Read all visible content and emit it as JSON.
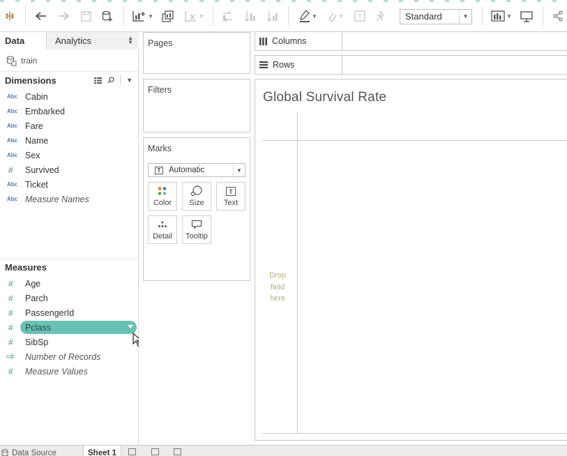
{
  "toolbar": {
    "standard_select": "Standard",
    "icons": [
      "tableau-logo-icon",
      "undo-icon",
      "redo-icon",
      "save-icon",
      "new-datasource-icon",
      "new-worksheet-icon",
      "duplicate-sheet-icon",
      "clear-sheet-icon",
      "swap-icon",
      "sort-ascending-icon",
      "sort-descending-icon",
      "highlight-icon",
      "group-icon",
      "label-icon",
      "pin-icon",
      "show-me-icon",
      "presentation-icon",
      "share-icon"
    ]
  },
  "datapane": {
    "tab_data": "Data",
    "tab_analytics": "Analytics",
    "datasource": "train",
    "dimensions_header": "Dimensions",
    "dimensions": [
      {
        "type": "Abc",
        "name": "Cabin"
      },
      {
        "type": "Abc",
        "name": "Embarked"
      },
      {
        "type": "Abc",
        "name": "Fare"
      },
      {
        "type": "Abc",
        "name": "Name"
      },
      {
        "type": "Abc",
        "name": "Sex"
      },
      {
        "type": "#",
        "name": "Survived"
      },
      {
        "type": "Abc",
        "name": "Ticket"
      },
      {
        "type": "Abc",
        "name": "Measure Names"
      }
    ],
    "measures_header": "Measures",
    "measures": [
      {
        "type": "#",
        "name": "Age"
      },
      {
        "type": "#",
        "name": "Parch"
      },
      {
        "type": "#",
        "name": "PassengerId"
      },
      {
        "type": "#",
        "name": "Pclass"
      },
      {
        "type": "#",
        "name": "SibSp"
      },
      {
        "type": "=#",
        "name": "Number of Records"
      },
      {
        "type": "#",
        "name": "Measure Values"
      }
    ]
  },
  "cards": {
    "pages": "Pages",
    "filters": "Filters",
    "marks": "Marks",
    "mark_type": "Automatic",
    "mark_type_icon": "T",
    "buttons": {
      "color": "Color",
      "size": "Size",
      "text": "Text",
      "detail": "Detail",
      "tooltip": "Tooltip"
    }
  },
  "shelves": {
    "columns": "Columns",
    "rows": "Rows"
  },
  "view": {
    "title": "Global Survival Rate",
    "drop_hint": "Drop field here"
  },
  "bottom_tabs": {
    "data_source": "Data Source",
    "sheet1": "Sheet 1"
  },
  "colors": {
    "selected_pill": "#68c2b4",
    "measure_icon": "#3f9a7e",
    "dimension_icon": "#4e79a7"
  }
}
